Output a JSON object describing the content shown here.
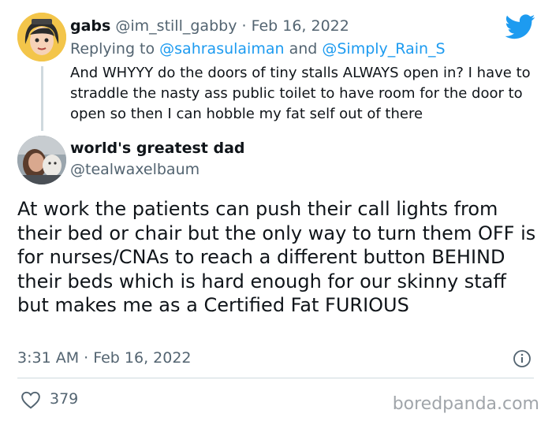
{
  "reply_tweet": {
    "display_name": "gabs",
    "handle": "@im_still_gabby",
    "separator": " · ",
    "date": "Feb 16, 2022",
    "replying_prefix": "Replying to ",
    "mention_1": "@sahrasulaiman",
    "and_word": " and ",
    "mention_2": "@Simply_Rain_S",
    "text": "And WHYYY do the doors of tiny stalls ALWAYS open in? I have to straddle the nasty ass public toilet to have room for the door to open so then I can hobble my fat self out of there"
  },
  "main_tweet": {
    "display_name": "world's greatest dad",
    "handle": "@tealwaxelbaum",
    "text": "At work the patients can push their call lights from their bed or chair but the only way to turn them OFF is for nurses/CNAs to reach a different button BEHIND their beds which is hard enough for our skinny staff but makes me as a Certified Fat FURIOUS",
    "timestamp": "3:31 AM · Feb 16, 2022",
    "like_count": "379"
  },
  "watermark": "boredpanda.com",
  "colors": {
    "twitter_blue": "#1d9bf0",
    "secondary_text": "#536471",
    "divider": "#cfd9de"
  },
  "icons": {
    "brand": "twitter-bird-icon",
    "info": "info-icon",
    "like": "heart-icon"
  }
}
